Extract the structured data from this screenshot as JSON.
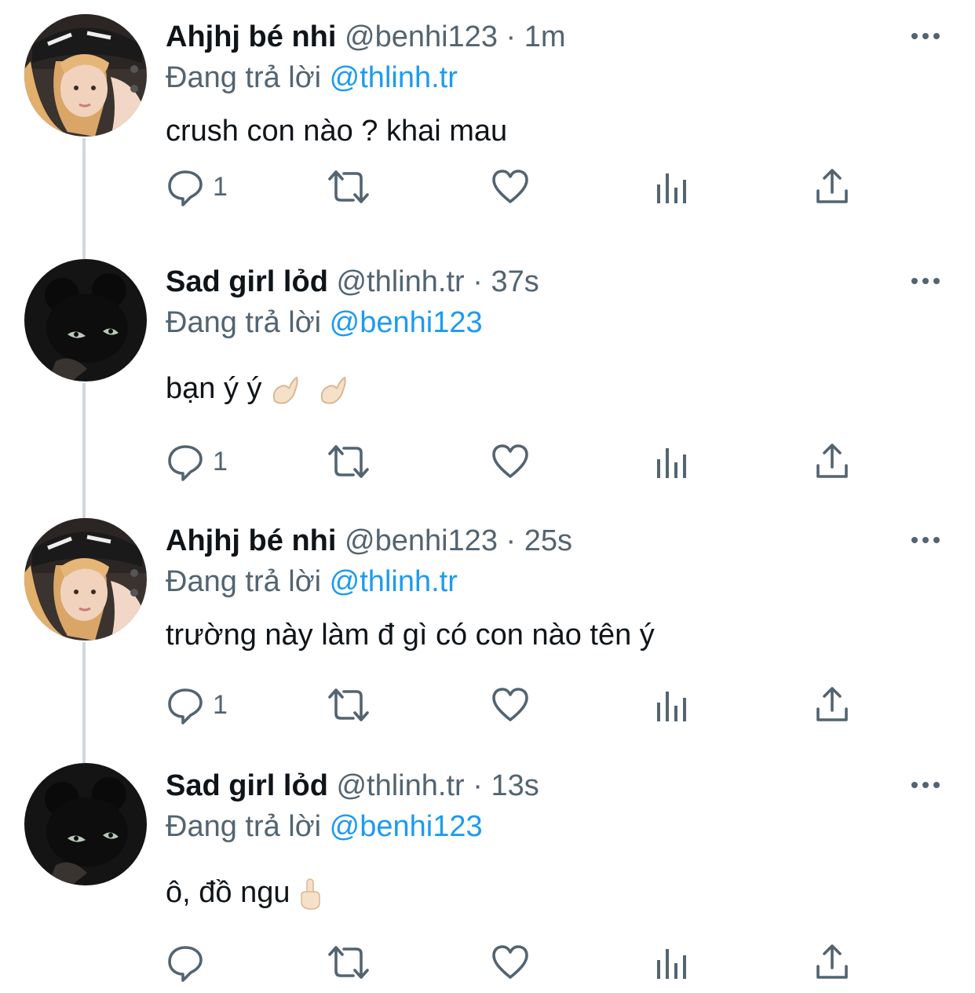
{
  "colors": {
    "text_primary": "#0f1419",
    "text_secondary": "#536471",
    "mention": "#1d9bf0",
    "connector": "#cfd9de"
  },
  "icons": {
    "reply": "reply-icon",
    "retweet": "retweet-icon",
    "like": "heart-icon",
    "views": "analytics-icon",
    "share": "share-icon",
    "more": "more-options-icon"
  },
  "tweets": [
    {
      "name": "Ahjhj bé nhi",
      "handle": "@benhi123",
      "sep": "·",
      "time": "1m",
      "reply_prefix": "Đang trả lời",
      "reply_to": "@thlinh.tr",
      "text": "crush con nào ? khai mau",
      "reply_count": "1"
    },
    {
      "name": "Sad girl lỏd",
      "handle": "@thlinh.tr",
      "sep": "·",
      "time": "37s",
      "reply_prefix": "Đang trả lời",
      "reply_to": "@benhi123",
      "text": "bạn ý ý",
      "reply_count": "1"
    },
    {
      "name": "Ahjhj bé nhi",
      "handle": "@benhi123",
      "sep": "·",
      "time": "25s",
      "reply_prefix": "Đang trả lời",
      "reply_to": "@thlinh.tr",
      "text": "trường này làm đ gì có con nào tên ý",
      "reply_count": "1"
    },
    {
      "name": "Sad girl lỏd",
      "handle": "@thlinh.tr",
      "sep": "·",
      "time": "13s",
      "reply_prefix": "Đang trả lời",
      "reply_to": "@benhi123",
      "text": "ô, đồ ngu",
      "reply_count": ""
    }
  ]
}
